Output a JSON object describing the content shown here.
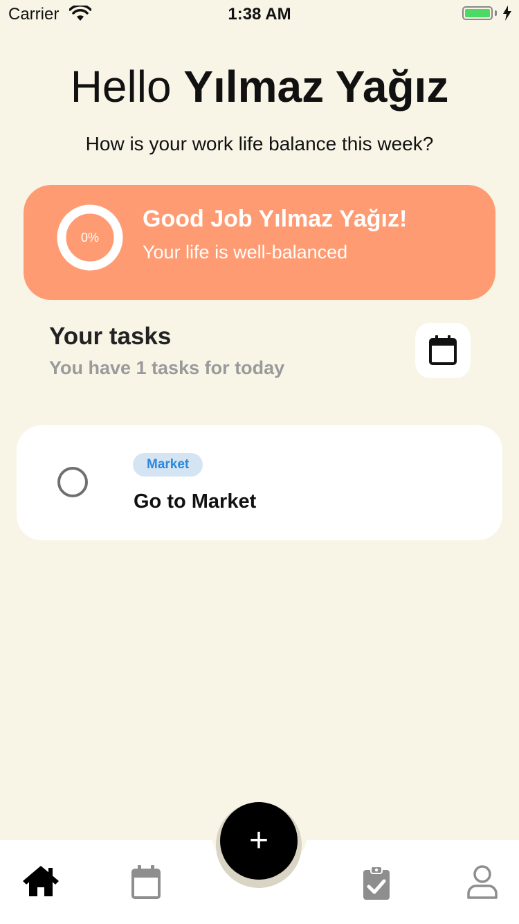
{
  "status_bar": {
    "carrier": "Carrier",
    "time": "1:38 AM"
  },
  "header": {
    "greeting_prefix": "Hello ",
    "user_name": "Yılmaz Yağız",
    "subtitle": "How is your work life balance this week?"
  },
  "balance_card": {
    "progress_label": "0%",
    "progress_value": 0,
    "title": "Good Job Yılmaz Yağız!",
    "message": "Your life is well-balanced",
    "color": "#ff9b72"
  },
  "tasks_section": {
    "title": "Your tasks",
    "subtitle": "You have 1 tasks for today"
  },
  "tasks": [
    {
      "tag": "Market",
      "title": "Go to Market",
      "done": false
    }
  ],
  "fab": {
    "label": "+"
  },
  "tab_bar": {
    "items": [
      {
        "icon": "home-icon",
        "active": true
      },
      {
        "icon": "calendar-icon",
        "active": false
      },
      {
        "icon": "clipboard-check-icon",
        "active": false
      },
      {
        "icon": "user-icon",
        "active": false
      }
    ]
  }
}
